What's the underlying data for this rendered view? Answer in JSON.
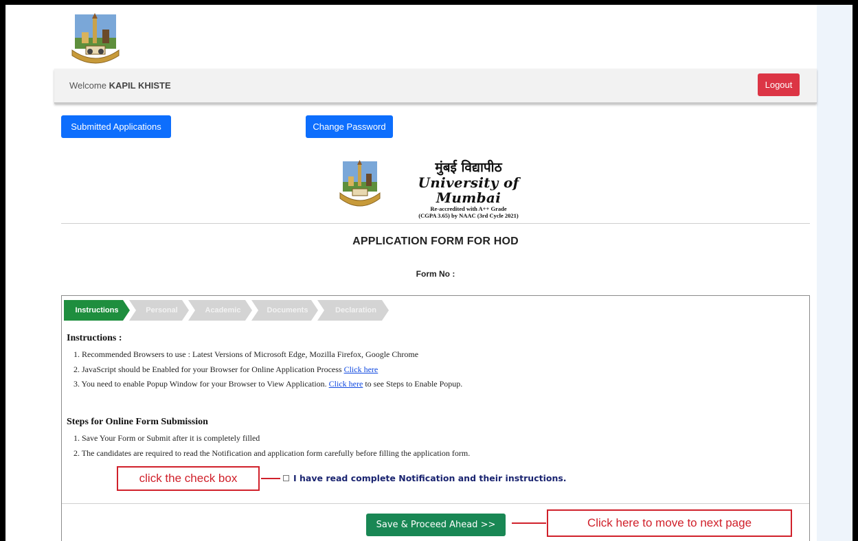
{
  "header": {
    "welcome_prefix": "Welcome",
    "user_name": "KAPIL KHISTE",
    "logout_label": "Logout"
  },
  "actions": {
    "submitted_label": "Submitted Applications",
    "change_password_label": "Change Password"
  },
  "university": {
    "name_marathi": "मुंबई विद्यापीठ",
    "name_english": "University of Mumbai",
    "accreditation_line1": "Re-accredited with A++ Grade",
    "accreditation_line2": "(CGPA 3.65) by NAAC (3rd Cycle 2021)"
  },
  "form": {
    "title": "APPLICATION FORM FOR HOD",
    "form_no_label": "Form No :"
  },
  "steps": [
    {
      "label": "Instructions",
      "active": true
    },
    {
      "label": "Personal",
      "active": false
    },
    {
      "label": "Academic",
      "active": false
    },
    {
      "label": "Documents",
      "active": false
    },
    {
      "label": "Declaration",
      "active": false
    }
  ],
  "instructions": {
    "heading": "Instructions :",
    "item1": "1. Recommended Browsers to use : Latest Versions of Microsoft Edge, Mozilla Firefox, Google Chrome",
    "item2_text": "2. JavaScript should be Enabled for your Browser for Online Application Process ",
    "item2_link": "Click here",
    "item3_text": "3. You need to enable Popup Window for your Browser to View Application. ",
    "item3_link": "Click here",
    "item3_suffix": " to see Steps to Enable Popup."
  },
  "submission_steps": {
    "heading": "Steps for Online Form Submission",
    "item1": "1. Save Your Form or Submit after it is completely filled",
    "item2": "2. The candidates are required to read the Notification and application form carefully before filling the application form."
  },
  "agreement": {
    "checkbox_label": "I have read complete Notification and their instructions.",
    "checked": false
  },
  "annotations": {
    "checkbox_hint": "click the check box",
    "next_hint": "Click here to move to next page",
    "color": "#d0202a"
  },
  "footer": {
    "save_label": "Save & Proceed Ahead >>"
  },
  "colors": {
    "primary": "#0d6efd",
    "danger": "#dc3545",
    "success": "#198754",
    "step_active": "#1e8e3e",
    "step_inactive": "#d4d4d4"
  }
}
